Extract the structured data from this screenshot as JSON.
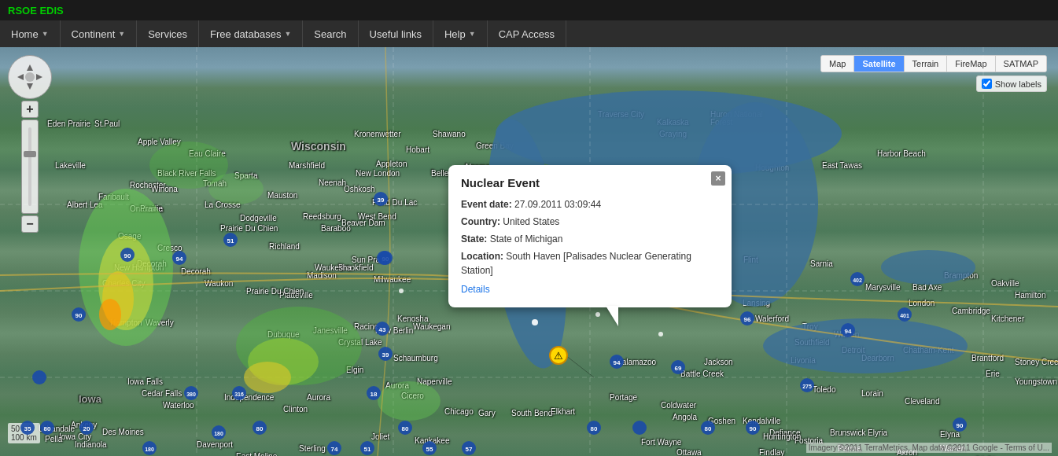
{
  "app": {
    "title": "RSOE EDIS"
  },
  "nav": {
    "items": [
      {
        "label": "Home",
        "hasArrow": true
      },
      {
        "label": "Continent",
        "hasArrow": true
      },
      {
        "label": "Services",
        "hasArrow": false
      },
      {
        "label": "Free databases",
        "hasArrow": true
      },
      {
        "label": "Search",
        "hasArrow": false
      },
      {
        "label": "Useful links",
        "hasArrow": false
      },
      {
        "label": "Help",
        "hasArrow": true
      },
      {
        "label": "CAP Access",
        "hasArrow": false
      }
    ]
  },
  "map_controls": {
    "zoom_plus": "+",
    "zoom_minus": "−",
    "type_buttons": [
      {
        "label": "Map",
        "active": false
      },
      {
        "label": "Satellite",
        "active": true
      },
      {
        "label": "Terrain",
        "active": false
      },
      {
        "label": "FireMap",
        "active": false
      },
      {
        "label": "SATMAP",
        "active": false
      }
    ],
    "show_labels": {
      "checked": true,
      "label": "Show labels"
    }
  },
  "popup": {
    "title": "Nuclear Event",
    "close_label": "×",
    "fields": [
      {
        "key": "Event date:",
        "value": "27.09.2011 03:09:44"
      },
      {
        "key": "Country:",
        "value": "United States"
      },
      {
        "key": "State:",
        "value": "State of Michigan"
      },
      {
        "key": "Location:",
        "value": "South Haven [Palisades Nuclear Generating Station]"
      }
    ],
    "details_link": "Details"
  },
  "scale": {
    "line1": "50 mi",
    "line2": "100 km"
  },
  "copyright": "Imagery ©2011 TerraMetrics, Map data ©2011 Google - Terms of U..."
}
